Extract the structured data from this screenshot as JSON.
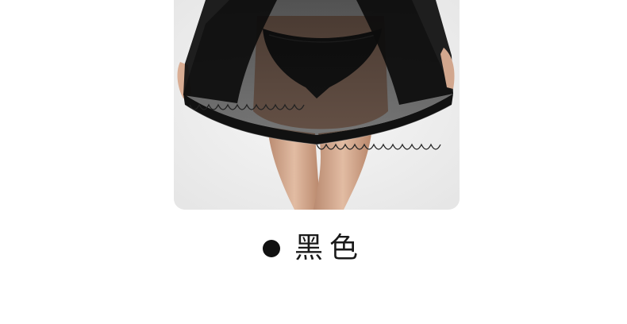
{
  "product": {
    "photo_alt": "",
    "color_label": "黑色",
    "swatch_color": "#111111"
  }
}
